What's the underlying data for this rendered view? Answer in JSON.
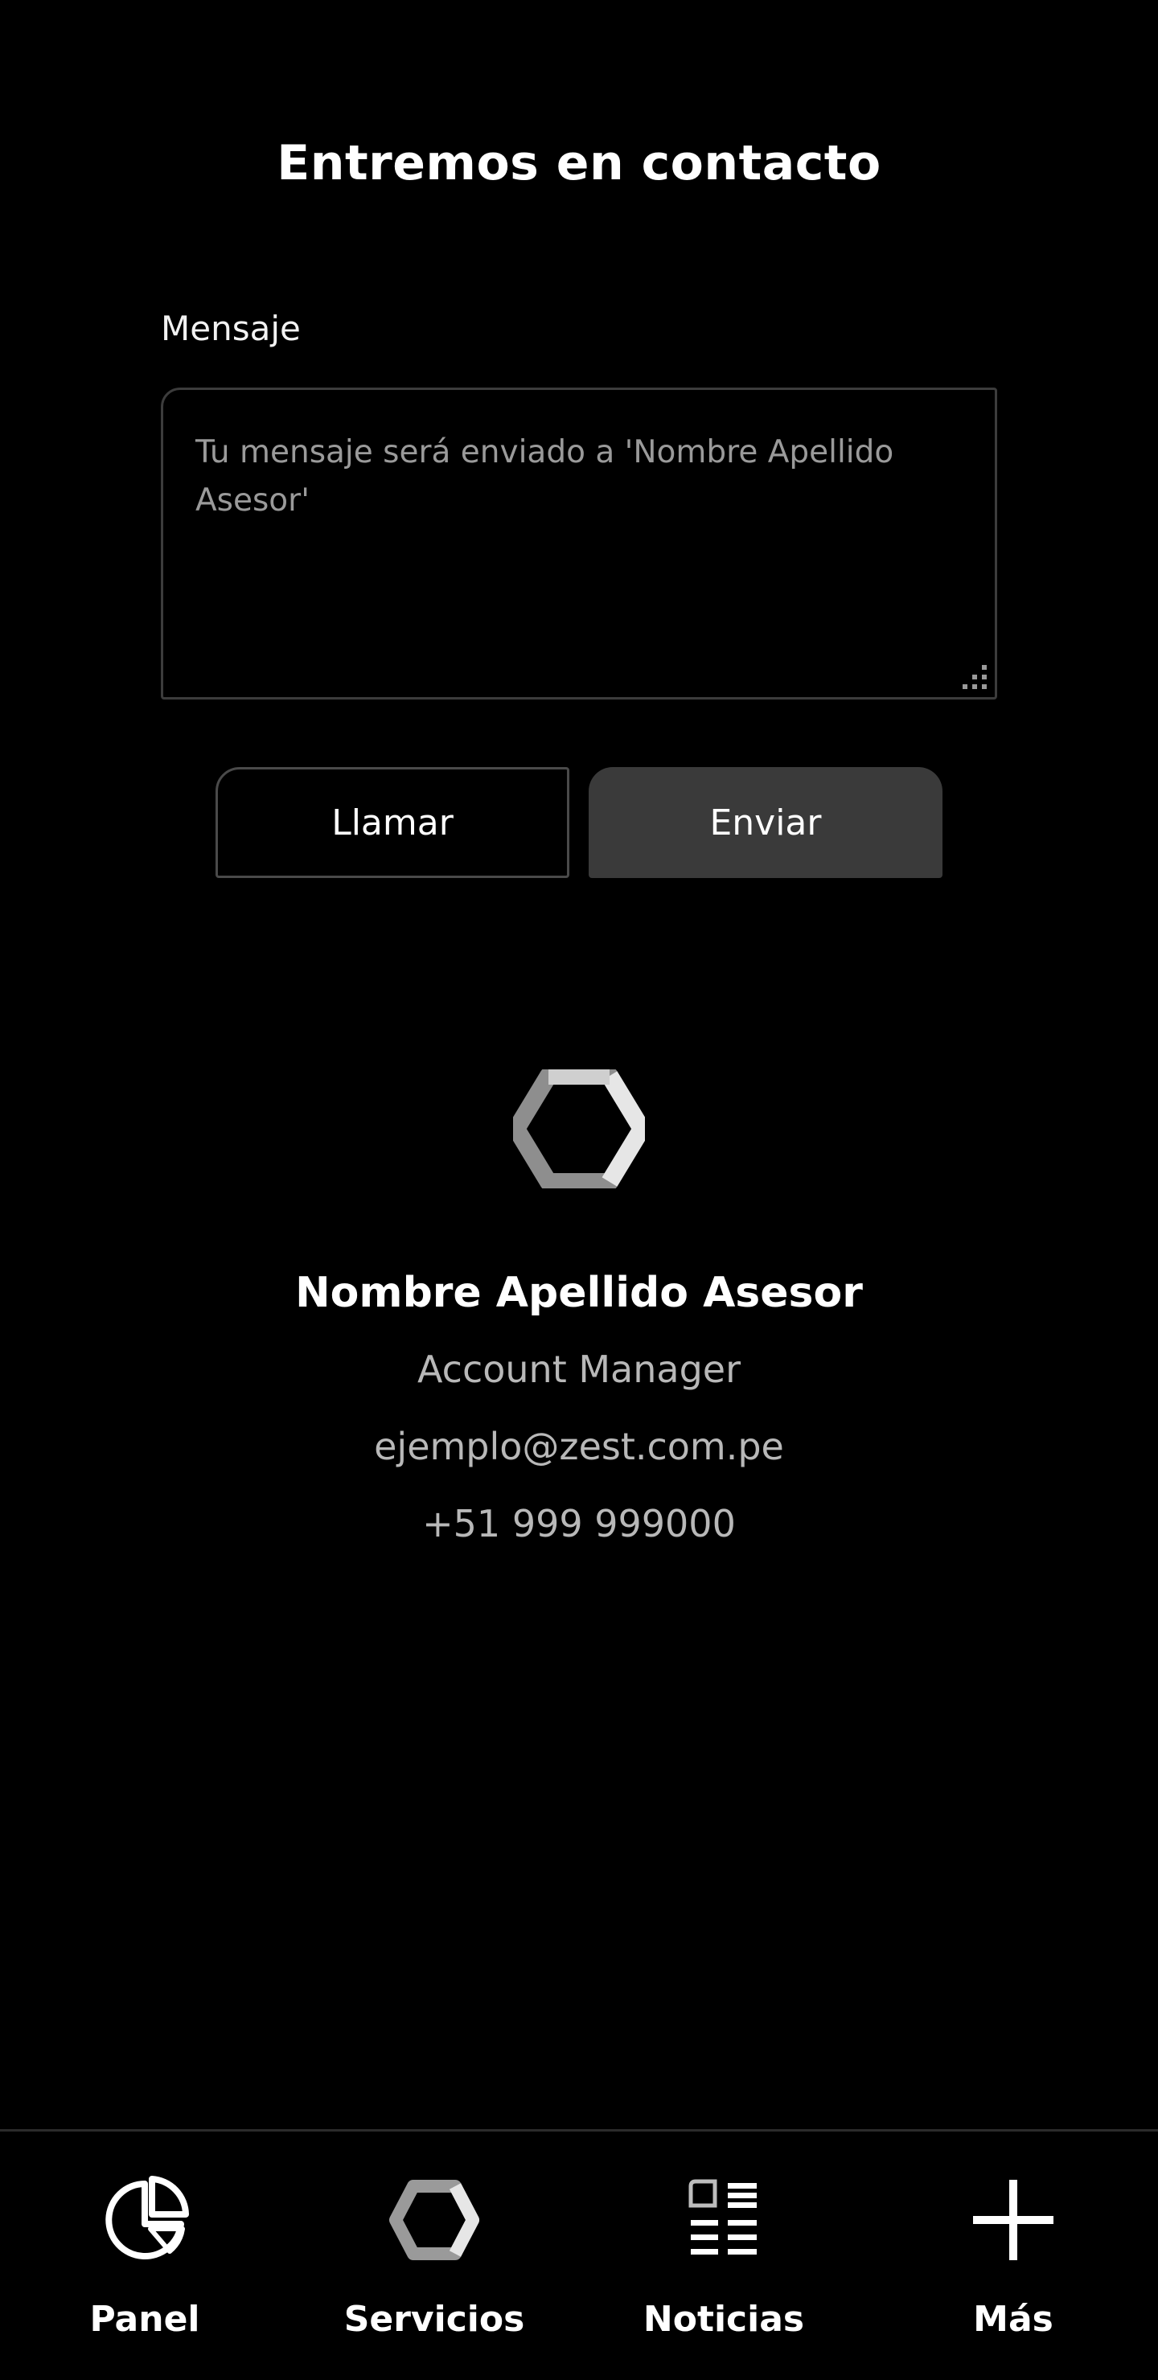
{
  "header": {
    "title": "Entremos en contacto"
  },
  "message": {
    "label": "Mensaje",
    "value": "",
    "placeholder": "Tu mensaje será enviado a 'Nombre Apellido Asesor'"
  },
  "actions": {
    "call_label": "Llamar",
    "send_label": "Enviar"
  },
  "advisor": {
    "logo_icon": "hexagon-logo-icon",
    "name": "Nombre Apellido Asesor",
    "role": "Account Manager",
    "email": "ejemplo@zest.com.pe",
    "phone": "+51 999 999000"
  },
  "bottom_nav": {
    "items": [
      {
        "label": "Panel",
        "icon": "pie-chart-icon"
      },
      {
        "label": "Servicios",
        "icon": "hexagon-icon"
      },
      {
        "label": "Noticias",
        "icon": "news-icon"
      },
      {
        "label": "Más",
        "icon": "plus-icon"
      }
    ]
  },
  "colors": {
    "background": "#000000",
    "send_button": "#3a3a3a",
    "muted_text": "#b8b8b8",
    "border": "#3c3c3c"
  }
}
